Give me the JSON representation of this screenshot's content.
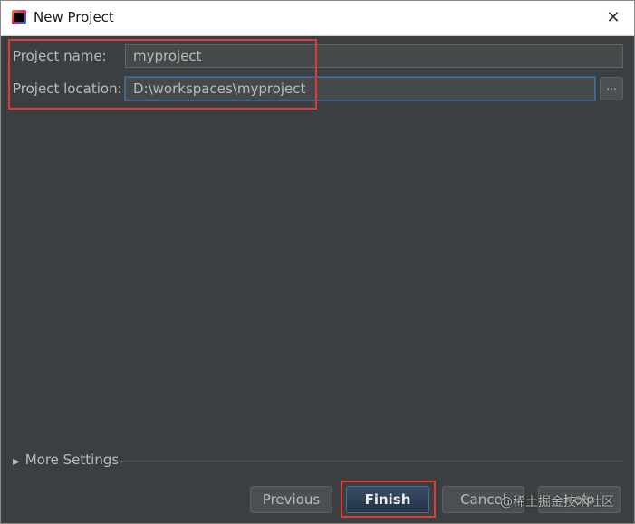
{
  "window": {
    "title": "New Project",
    "close_glyph": "✕",
    "app_icon": "intellij-idea-icon"
  },
  "form": {
    "project_name_label": "Project name:",
    "project_name_value": "myproject",
    "project_location_label": "Project location:",
    "project_location_value": "D:\\workspaces\\myproject",
    "browse_label": "..."
  },
  "more_settings": {
    "arrow": "▶",
    "label": "More Settings"
  },
  "buttons": {
    "previous": "Previous",
    "finish": "Finish",
    "cancel": "Cancel",
    "help": "Help"
  },
  "watermark": "@稀土掘金技术社区",
  "colors": {
    "dialog_bg": "#3c3f41",
    "highlight_box": "#e23a3a",
    "primary_button": "#365880"
  }
}
